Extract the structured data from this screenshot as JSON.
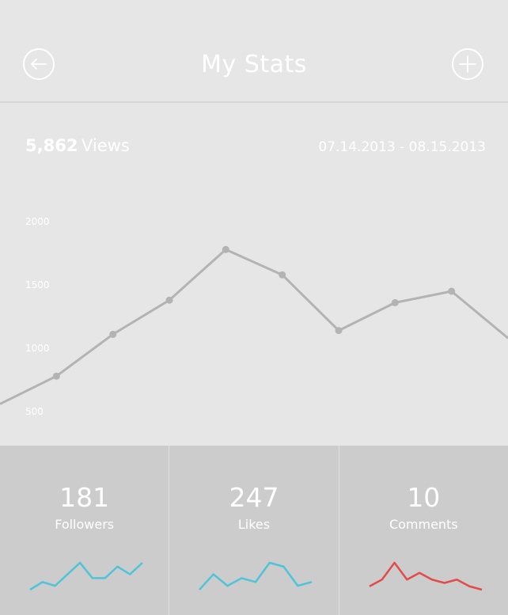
{
  "header": {
    "title": "My Stats",
    "back_icon": "arrow-left-circle-icon",
    "add_icon": "plus-circle-icon"
  },
  "summary": {
    "views_count": "5,862",
    "views_label": "Views",
    "date_range": "07.14.2013 - 08.15.2013"
  },
  "chart_data": {
    "type": "line",
    "title": "",
    "xlabel": "",
    "ylabel": "",
    "y_ticks": [
      "2000",
      "1500",
      "1000",
      "500"
    ],
    "ylim": [
      250,
      2250
    ],
    "grid": false,
    "series": [
      {
        "x": [
          0,
          1,
          2,
          3,
          4,
          5,
          6,
          7,
          8,
          9
        ],
        "values": [
          560,
          780,
          1110,
          1380,
          1780,
          1580,
          1140,
          1360,
          1450,
          1080
        ],
        "markers": [
          false,
          true,
          true,
          true,
          true,
          true,
          true,
          true,
          true,
          false
        ]
      }
    ]
  },
  "stats": [
    {
      "value": "181",
      "label": "Followers",
      "spark": [
        1,
        3,
        2,
        5,
        8,
        4,
        4,
        7,
        5,
        8
      ],
      "color": "#4fc3d9"
    },
    {
      "value": "247",
      "label": "Likes",
      "spark": [
        1,
        5,
        2,
        4,
        3,
        8,
        7,
        2,
        3
      ],
      "color": "#4fc3d9"
    },
    {
      "value": "10",
      "label": "Comments",
      "spark": [
        4,
        6,
        11,
        6,
        8,
        6,
        5,
        6,
        4,
        3
      ],
      "color": "#e34b4b"
    }
  ],
  "colors": {
    "background": "#e6e6e6",
    "stats_background": "#cccccc",
    "chart_line": "#b3b3b3",
    "text": "#ffffff"
  }
}
